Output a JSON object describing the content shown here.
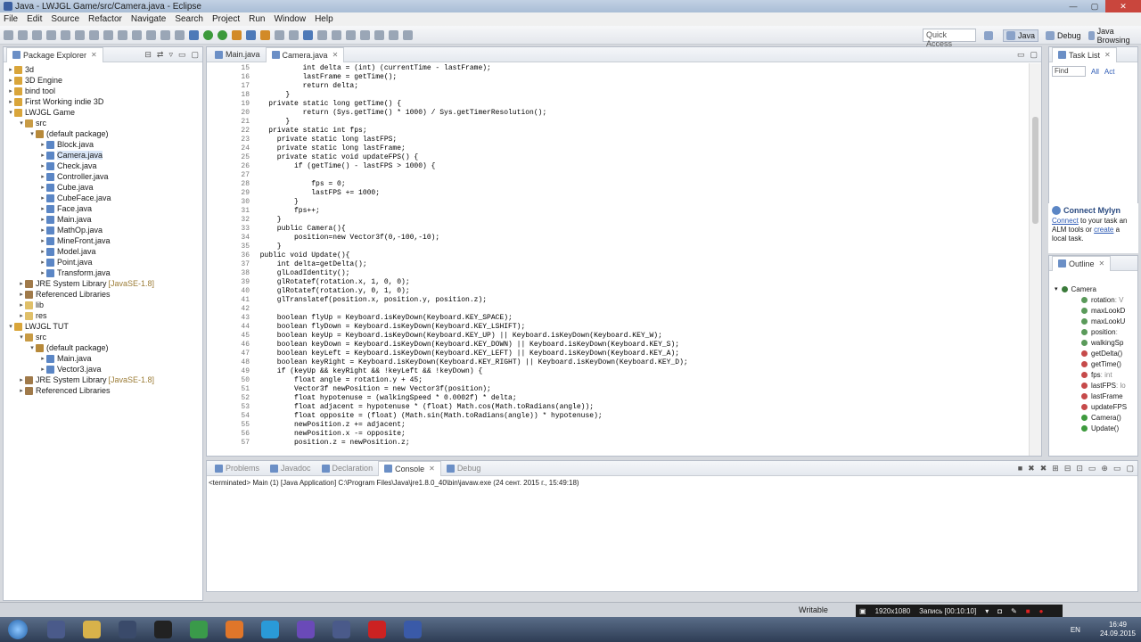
{
  "window": {
    "title": "Java - LWJGL Game/src/Camera.java - Eclipse"
  },
  "menu": [
    "File",
    "Edit",
    "Source",
    "Refactor",
    "Navigate",
    "Search",
    "Project",
    "Run",
    "Window",
    "Help"
  ],
  "toolbar": {
    "quick_access": "Quick Access",
    "perspectives": [
      "Java",
      "Debug",
      "Java Browsing"
    ]
  },
  "package_explorer": {
    "title": "Package Explorer",
    "nodes": [
      {
        "label": "3d",
        "depth": 0,
        "type": "proj",
        "arrow": "▸"
      },
      {
        "label": "3D Engine",
        "depth": 0,
        "type": "proj",
        "arrow": "▸"
      },
      {
        "label": "bind tool",
        "depth": 0,
        "type": "proj",
        "arrow": "▸"
      },
      {
        "label": "First Working indie 3D",
        "depth": 0,
        "type": "proj",
        "arrow": "▸"
      },
      {
        "label": "LWJGL Game",
        "depth": 0,
        "type": "proj",
        "arrow": "▾"
      },
      {
        "label": "src",
        "depth": 1,
        "type": "src",
        "arrow": "▾"
      },
      {
        "label": "(default package)",
        "depth": 2,
        "type": "pkg",
        "arrow": "▾"
      },
      {
        "label": "Block.java",
        "depth": 3,
        "type": "java",
        "arrow": "▸"
      },
      {
        "label": "Camera.java",
        "depth": 3,
        "type": "java",
        "arrow": "▸",
        "selected": true
      },
      {
        "label": "Check.java",
        "depth": 3,
        "type": "java",
        "arrow": "▸"
      },
      {
        "label": "Controller.java",
        "depth": 3,
        "type": "java",
        "arrow": "▸"
      },
      {
        "label": "Cube.java",
        "depth": 3,
        "type": "java",
        "arrow": "▸"
      },
      {
        "label": "CubeFace.java",
        "depth": 3,
        "type": "java",
        "arrow": "▸"
      },
      {
        "label": "Face.java",
        "depth": 3,
        "type": "java",
        "arrow": "▸"
      },
      {
        "label": "Main.java",
        "depth": 3,
        "type": "java",
        "arrow": "▸"
      },
      {
        "label": "MathOp.java",
        "depth": 3,
        "type": "java",
        "arrow": "▸"
      },
      {
        "label": "MineFront.java",
        "depth": 3,
        "type": "java",
        "arrow": "▸"
      },
      {
        "label": "Model.java",
        "depth": 3,
        "type": "java",
        "arrow": "▸"
      },
      {
        "label": "Point.java",
        "depth": 3,
        "type": "java",
        "arrow": "▸"
      },
      {
        "label": "Transform.java",
        "depth": 3,
        "type": "java",
        "arrow": "▸"
      },
      {
        "label": "JRE System Library",
        "extra": "[JavaSE-1.8]",
        "depth": 1,
        "type": "lib",
        "arrow": "▸"
      },
      {
        "label": "Referenced Libraries",
        "depth": 1,
        "type": "lib",
        "arrow": "▸"
      },
      {
        "label": "lib",
        "depth": 1,
        "type": "folder",
        "arrow": "▸"
      },
      {
        "label": "res",
        "depth": 1,
        "type": "folder",
        "arrow": "▸"
      },
      {
        "label": "LWJGL TUT",
        "depth": 0,
        "type": "proj",
        "arrow": "▾"
      },
      {
        "label": "src",
        "depth": 1,
        "type": "src",
        "arrow": "▾"
      },
      {
        "label": "(default package)",
        "depth": 2,
        "type": "pkg",
        "arrow": "▾"
      },
      {
        "label": "Main.java",
        "depth": 3,
        "type": "java",
        "arrow": "▸"
      },
      {
        "label": "Vector3.java",
        "depth": 3,
        "type": "java",
        "arrow": "▸"
      },
      {
        "label": "JRE System Library",
        "extra": "[JavaSE-1.8]",
        "depth": 1,
        "type": "lib",
        "arrow": "▸"
      },
      {
        "label": "Referenced Libraries",
        "depth": 1,
        "type": "lib",
        "arrow": "▸"
      }
    ]
  },
  "editor": {
    "tabs": [
      "Main.java",
      "Camera.java"
    ],
    "active_tab": "Camera.java",
    "lines": [
      {
        "n": "15",
        "t": "            int delta = (int) (currentTime - lastFrame);"
      },
      {
        "n": "16",
        "t": "            lastFrame = getTime();"
      },
      {
        "n": "17",
        "t": "            return delta;"
      },
      {
        "n": "18",
        "t": "        }"
      },
      {
        "n": "19",
        "t": "    private static long getTime() {"
      },
      {
        "n": "20",
        "t": "            return (Sys.getTime() * 1000) / Sys.getTimerResolution();"
      },
      {
        "n": "21",
        "t": "        }"
      },
      {
        "n": "22",
        "t": "    private static int fps;"
      },
      {
        "n": "23",
        "t": "      private static long lastFPS;"
      },
      {
        "n": "24",
        "t": "      private static long lastFrame;"
      },
      {
        "n": "25",
        "t": "      private static void updateFPS() {"
      },
      {
        "n": "26",
        "t": "          if (getTime() - lastFPS > 1000) {"
      },
      {
        "n": "27",
        "t": ""
      },
      {
        "n": "28",
        "t": "              fps = 0;"
      },
      {
        "n": "29",
        "t": "              lastFPS += 1000;"
      },
      {
        "n": "30",
        "t": "          }"
      },
      {
        "n": "31",
        "t": "          fps++;"
      },
      {
        "n": "32",
        "t": "      }"
      },
      {
        "n": "33",
        "t": "      public Camera(){"
      },
      {
        "n": "34",
        "t": "          position=new Vector3f(0,-100,-10);"
      },
      {
        "n": "35",
        "t": "      }"
      },
      {
        "n": "36",
        "t": "  public void Update(){"
      },
      {
        "n": "37",
        "t": "      int delta=getDelta();"
      },
      {
        "n": "38",
        "t": "      glLoadIdentity();"
      },
      {
        "n": "39",
        "t": "      glRotatef(rotation.x, 1, 0, 0);"
      },
      {
        "n": "40",
        "t": "      glRotatef(rotation.y, 0, 1, 0);"
      },
      {
        "n": "41",
        "t": "      glTranslatef(position.x, position.y, position.z);"
      },
      {
        "n": "42",
        "t": ""
      },
      {
        "n": "43",
        "t": "      boolean flyUp = Keyboard.isKeyDown(Keyboard.KEY_SPACE);"
      },
      {
        "n": "44",
        "t": "      boolean flyDown = Keyboard.isKeyDown(Keyboard.KEY_LSHIFT);"
      },
      {
        "n": "45",
        "t": "      boolean keyUp = Keyboard.isKeyDown(Keyboard.KEY_UP) || Keyboard.isKeyDown(Keyboard.KEY_W);"
      },
      {
        "n": "46",
        "t": "      boolean keyDown = Keyboard.isKeyDown(Keyboard.KEY_DOWN) || Keyboard.isKeyDown(Keyboard.KEY_S);"
      },
      {
        "n": "47",
        "t": "      boolean keyLeft = Keyboard.isKeyDown(Keyboard.KEY_LEFT) || Keyboard.isKeyDown(Keyboard.KEY_A);"
      },
      {
        "n": "48",
        "t": "      boolean keyRight = Keyboard.isKeyDown(Keyboard.KEY_RIGHT) || Keyboard.isKeyDown(Keyboard.KEY_D);"
      },
      {
        "n": "49",
        "t": "      if (keyUp && keyRight && !keyLeft && !keyDown) {"
      },
      {
        "n": "50",
        "t": "          float angle = rotation.y + 45;"
      },
      {
        "n": "51",
        "t": "          Vector3f newPosition = new Vector3f(position);"
      },
      {
        "n": "52",
        "t": "          float hypotenuse = (walkingSpeed * 0.0002f) * delta;"
      },
      {
        "n": "53",
        "t": "          float adjacent = hypotenuse * (float) Math.cos(Math.toRadians(angle));"
      },
      {
        "n": "54",
        "t": "          float opposite = (float) (Math.sin(Math.toRadians(angle)) * hypotenuse);"
      },
      {
        "n": "55",
        "t": "          newPosition.z += adjacent;"
      },
      {
        "n": "56",
        "t": "          newPosition.x -= opposite;"
      },
      {
        "n": "57",
        "t": "          position.z = newPosition.z;"
      }
    ]
  },
  "console": {
    "tabs": [
      "Problems",
      "Javadoc",
      "Declaration",
      "Console",
      "Debug"
    ],
    "active_tab": "Console",
    "status": "<terminated> Main (1) [Java Application] C:\\Program Files\\Java\\jre1.8.0_40\\bin\\javaw.exe (24 сент. 2015 г., 15:49:18)"
  },
  "task_list": {
    "title": "Task List",
    "find": "Find",
    "all": "All",
    "act": "Act"
  },
  "mylyn": {
    "title": "Connect Mylyn",
    "connect_link": "Connect",
    "text_1": " to your task an",
    "text_2": "ALM tools or ",
    "create_link": "create",
    "text_3": " a",
    "text_4": "local task."
  },
  "outline": {
    "title": "Outline",
    "class": "Camera",
    "members": [
      {
        "label": "rotation",
        "extra": " : V",
        "kind": "field"
      },
      {
        "label": "maxLookD",
        "extra": "",
        "kind": "field"
      },
      {
        "label": "maxLookU",
        "extra": "",
        "kind": "field"
      },
      {
        "label": "position",
        "extra": " : ",
        "kind": "field"
      },
      {
        "label": "walkingSp",
        "extra": "",
        "kind": "field"
      },
      {
        "label": "getDelta()",
        "extra": "",
        "kind": "method"
      },
      {
        "label": "getTime()",
        "extra": "",
        "kind": "method"
      },
      {
        "label": "fps",
        "extra": " : int",
        "kind": "method"
      },
      {
        "label": "lastFPS",
        "extra": " : lo",
        "kind": "method"
      },
      {
        "label": "lastFrame",
        "extra": "",
        "kind": "method"
      },
      {
        "label": "updateFPS",
        "extra": "",
        "kind": "method"
      },
      {
        "label": "Camera()",
        "extra": "",
        "kind": "pmethod"
      },
      {
        "label": "Update()",
        "extra": "",
        "kind": "pmethod"
      }
    ]
  },
  "statusbar": {
    "writable": "Writable",
    "recorder": {
      "resolution": "1920x1080",
      "recording": "Запись [00:10:10]"
    }
  },
  "taskbar": {
    "apps": [
      "Eclipse",
      "Explorer",
      "Steam",
      "Unity",
      "Chrome",
      "Firefox",
      "Skype",
      "Visual Studio",
      "App",
      "Recorder",
      "Eclipse"
    ],
    "app_colors": [
      "#4a5a8a",
      "#d8b24a",
      "#3a4a6a",
      "#222222",
      "#3a9a4a",
      "#e0762a",
      "#2a9ad8",
      "#6a4ab8",
      "#4a5a8a",
      "#cc2222",
      "#3a5aa8"
    ],
    "lang": "EN",
    "time": "16:49",
    "date": "24.09.2015"
  }
}
